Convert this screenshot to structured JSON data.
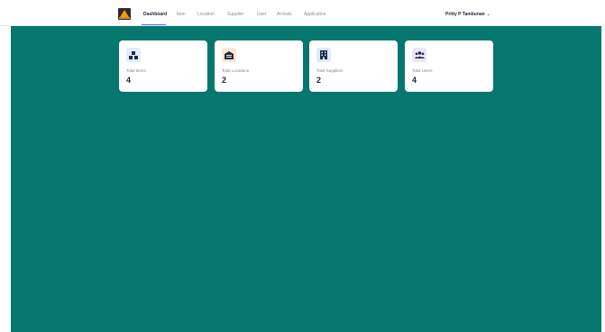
{
  "nav": {
    "links": [
      {
        "label": "Dashboard",
        "active": true
      },
      {
        "label": "Item"
      },
      {
        "label": "Location"
      },
      {
        "label": "Supplier"
      },
      {
        "label": "User"
      },
      {
        "label": "Arrivals"
      },
      {
        "label": "Application"
      }
    ],
    "user_name": "Pritty P Tambunan",
    "user_chevron": "chevron-down-icon"
  },
  "cards": [
    {
      "label": "Total Items",
      "value": "4",
      "icon": "boxes-icon",
      "icon_bg": "#e3ecfb",
      "icon_color": "#1f2a4d"
    },
    {
      "label": "Total Locations",
      "value": "2",
      "icon": "warehouse-icon",
      "icon_bg": "#fde6cf",
      "icon_color": "#1f2a4d"
    },
    {
      "label": "Total Suppliers",
      "value": "2",
      "icon": "building-icon",
      "icon_bg": "#dfe9fb",
      "icon_color": "#1f2a4d"
    },
    {
      "label": "Total Users",
      "value": "4",
      "icon": "users-icon",
      "icon_bg": "#ece4fb",
      "icon_color": "#1f2a4d"
    }
  ],
  "colors": {
    "main_bg": "#06776e",
    "accent": "#5b6bf0"
  }
}
